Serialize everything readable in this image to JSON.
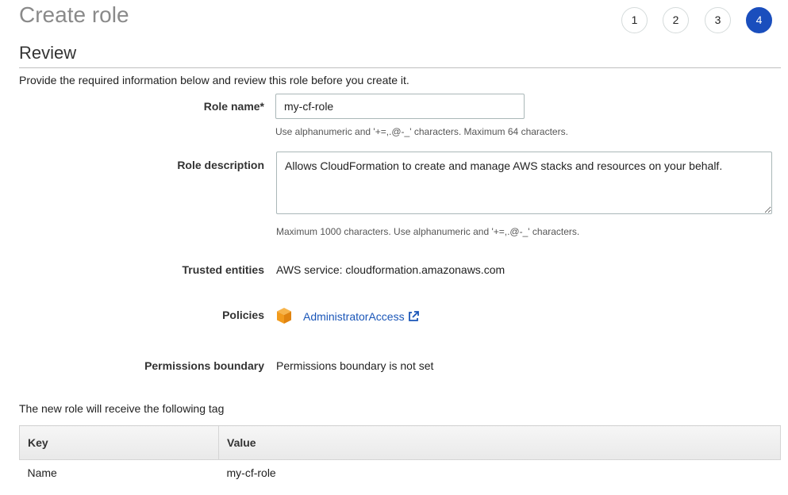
{
  "page": {
    "title": "Create role",
    "steps": [
      "1",
      "2",
      "3",
      "4"
    ],
    "active_step": "4",
    "section_title": "Review",
    "intro": "Provide the required information below and review this role before you create it."
  },
  "form": {
    "role_name_label": "Role name*",
    "role_name_value": "my-cf-role",
    "role_name_hint": "Use alphanumeric and '+=,.@-_' characters. Maximum 64 characters.",
    "role_description_label": "Role description",
    "role_description_value": "Allows CloudFormation to create and manage AWS stacks and resources on your behalf.",
    "role_description_hint": "Maximum 1000 characters. Use alphanumeric and '+=,.@-_' characters.",
    "trusted_entities_label": "Trusted entities",
    "trusted_entities_value": "AWS service: cloudformation.amazonaws.com",
    "policies_label": "Policies",
    "policies": [
      {
        "name": "AdministratorAccess",
        "icon": "aws-cube-icon",
        "link_icon": "external-link-icon"
      }
    ],
    "permissions_boundary_label": "Permissions boundary",
    "permissions_boundary_value": "Permissions boundary is not set"
  },
  "tags": {
    "intro": "The new role will receive the following tag",
    "headers": [
      "Key",
      "Value"
    ],
    "rows": [
      [
        "Name",
        "my-cf-role"
      ]
    ]
  },
  "colors": {
    "accent": "#1a4ebd",
    "link": "#1a56b8",
    "policy_icon": "#f29b1d"
  }
}
